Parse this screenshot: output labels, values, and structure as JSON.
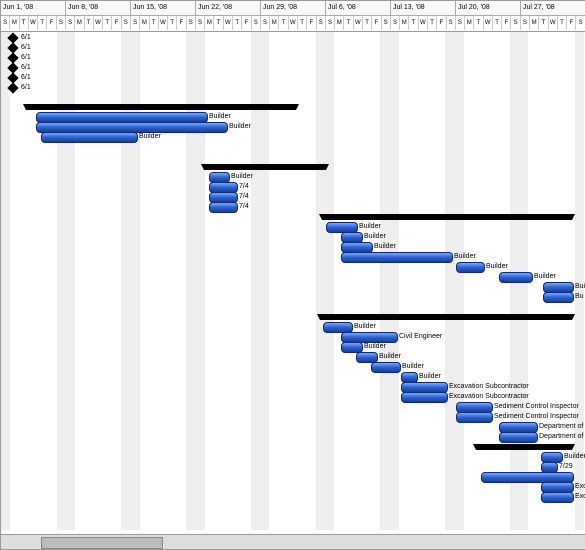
{
  "chart_data": {
    "type": "gantt",
    "timeline": {
      "weeks": [
        "Jun 1, '08",
        "Jun 8, '08",
        "Jun 15, '08",
        "Jun 22, '08",
        "Jun 29, '08",
        "Jul 6, '08",
        "Jul 13, '08",
        "Jul 20, '08",
        "Jul 27, '08"
      ],
      "days_pattern": [
        "S",
        "M",
        "T",
        "W",
        "T",
        "F",
        "S"
      ]
    },
    "milestones": [
      {
        "date": "6/1",
        "row": 0
      },
      {
        "date": "6/1",
        "row": 1
      },
      {
        "date": "6/1",
        "row": 2
      },
      {
        "date": "6/1",
        "row": 3
      },
      {
        "date": "6/1",
        "row": 4
      },
      {
        "date": "6/1",
        "row": 5
      }
    ],
    "summaries": [
      {
        "row": 7,
        "start": 25,
        "end": 295
      },
      {
        "row": 13,
        "start": 203,
        "end": 325
      },
      {
        "row": 18,
        "start": 321,
        "end": 571
      },
      {
        "row": 28,
        "start": 319,
        "end": 571
      },
      {
        "row": 41,
        "start": 475,
        "end": 571
      }
    ],
    "tasks": [
      {
        "row": 8,
        "start": 35,
        "end": 205,
        "label": "Builder"
      },
      {
        "row": 9,
        "start": 35,
        "end": 225,
        "label": "Builder"
      },
      {
        "row": 10,
        "start": 40,
        "end": 135,
        "label": "Builder"
      },
      {
        "row": 14,
        "start": 208,
        "end": 227,
        "label": "Builder"
      },
      {
        "row": 15,
        "start": 208,
        "end": 235,
        "label": "7/4"
      },
      {
        "row": 16,
        "start": 208,
        "end": 235,
        "label": "7/4"
      },
      {
        "row": 17,
        "start": 208,
        "end": 235,
        "label": "7/4"
      },
      {
        "row": 19,
        "start": 325,
        "end": 355,
        "label": "Builder"
      },
      {
        "row": 20,
        "start": 340,
        "end": 360,
        "label": "Builder"
      },
      {
        "row": 21,
        "start": 340,
        "end": 370,
        "label": "Builder"
      },
      {
        "row": 22,
        "start": 340,
        "end": 450,
        "label": "Builder"
      },
      {
        "row": 23,
        "start": 455,
        "end": 482,
        "label": "Builder"
      },
      {
        "row": 24,
        "start": 498,
        "end": 530,
        "label": "Builder"
      },
      {
        "row": 25,
        "start": 542,
        "end": 571,
        "label": "Builder"
      },
      {
        "row": 26,
        "start": 542,
        "end": 571,
        "label": "Bu"
      },
      {
        "row": 29,
        "start": 322,
        "end": 350,
        "label": "Builder"
      },
      {
        "row": 30,
        "start": 340,
        "end": 395,
        "label": "Civil Engineer"
      },
      {
        "row": 31,
        "start": 340,
        "end": 360,
        "label": "Builder"
      },
      {
        "row": 32,
        "start": 355,
        "end": 375,
        "label": "Builder"
      },
      {
        "row": 33,
        "start": 370,
        "end": 398,
        "label": "Builder"
      },
      {
        "row": 34,
        "start": 400,
        "end": 415,
        "label": "Builder"
      },
      {
        "row": 35,
        "start": 400,
        "end": 445,
        "label": "Excavation Subcontractor"
      },
      {
        "row": 36,
        "start": 400,
        "end": 445,
        "label": "Excavation Subcontractor"
      },
      {
        "row": 37,
        "start": 455,
        "end": 490,
        "label": "Sediment Control Inspector"
      },
      {
        "row": 38,
        "start": 455,
        "end": 490,
        "label": "Sediment Control Inspector"
      },
      {
        "row": 39,
        "start": 498,
        "end": 535,
        "label": "Department of Permits &"
      },
      {
        "row": 40,
        "start": 498,
        "end": 535,
        "label": "Department of Permits"
      },
      {
        "row": 42,
        "start": 540,
        "end": 560,
        "label": "Builder"
      },
      {
        "row": 43,
        "start": 540,
        "end": 555,
        "label": "7/29"
      },
      {
        "row": 44,
        "start": 480,
        "end": 571,
        "label": ""
      },
      {
        "row": 45,
        "start": 540,
        "end": 571,
        "label": "Excavation Subcont"
      },
      {
        "row": 46,
        "start": 540,
        "end": 571,
        "label": "Excavation"
      }
    ]
  },
  "colors": {
    "bar": "#2a5fd0",
    "weekend": "#eee"
  }
}
